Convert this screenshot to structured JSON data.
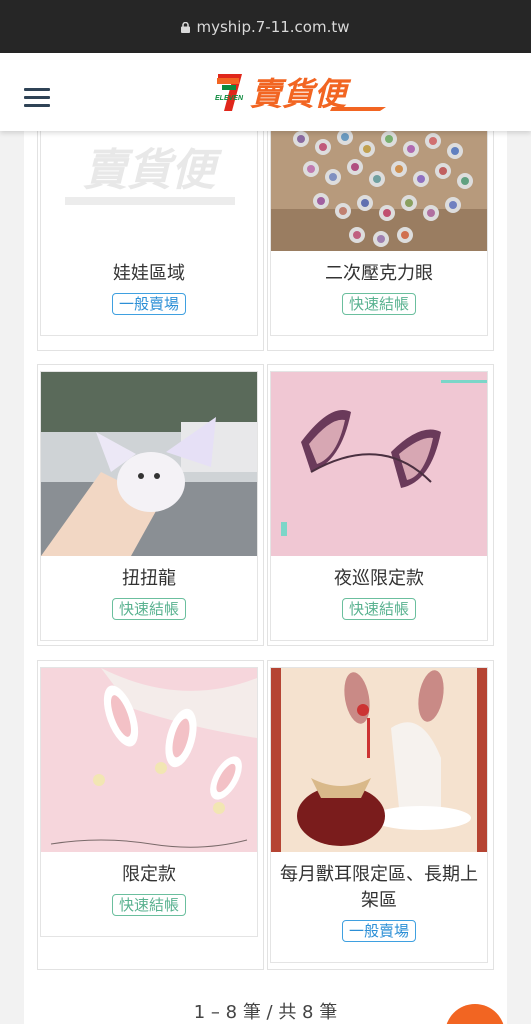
{
  "browser": {
    "url": "myship.7-11.com.tw"
  },
  "header": {
    "logo_text": "賣貨便",
    "logo_sub": "ELEVEN"
  },
  "products": [
    {
      "title": "娃娃區域",
      "badge": "一般賣場",
      "badge_color": "#2c8fd6"
    },
    {
      "title": "二次壓克力眼",
      "badge": "快速結帳",
      "badge_color": "#5ab290"
    },
    {
      "title": "扭扭龍",
      "badge": "快速結帳",
      "badge_color": "#5ab290"
    },
    {
      "title": "夜巡限定款",
      "badge": "快速結帳",
      "badge_color": "#5ab290"
    },
    {
      "title": "限定款",
      "badge": "快速結帳",
      "badge_color": "#5ab290"
    },
    {
      "title": "每月獸耳限定區、長期上架區",
      "badge": "一般賣場",
      "badge_color": "#2c8fd6"
    }
  ],
  "pagination": {
    "text": "1 – 8 筆 / 共 8 筆"
  },
  "colors": {
    "accent": "#f26522",
    "brand_red": "#e0271b",
    "brand_green": "#0d8a3e"
  }
}
